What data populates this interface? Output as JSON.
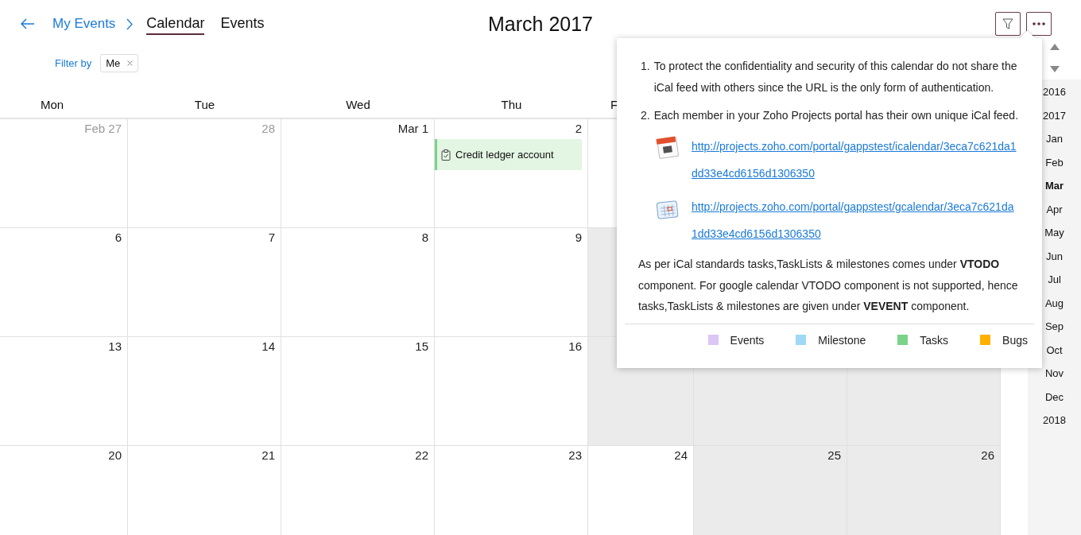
{
  "breadcrumb": "My Events",
  "tabs": [
    {
      "label": "Calendar",
      "selected": true
    },
    {
      "label": "Events",
      "selected": false
    }
  ],
  "title": "March 2017",
  "filter": {
    "label": "Filter by",
    "chips": [
      "Me"
    ]
  },
  "weekdays": [
    "Mon",
    "Tue",
    "Wed",
    "Thu",
    "F"
  ],
  "weeks": [
    {
      "days": [
        {
          "label": "Feb 27",
          "other_month": true
        },
        {
          "label": "28",
          "other_month": true
        },
        {
          "label": "Mar 1",
          "other_month": false
        },
        {
          "label": "2",
          "other_month": false,
          "events": [
            {
              "title": "Credit ledger account",
              "color": "#7bd389"
            }
          ]
        },
        {
          "shaded": false
        }
      ]
    },
    {
      "days": [
        {
          "label": "6"
        },
        {
          "label": "7"
        },
        {
          "label": "8"
        },
        {
          "label": "9"
        },
        {
          "shaded": true
        }
      ]
    },
    {
      "days": [
        {
          "label": "13"
        },
        {
          "label": "14"
        },
        {
          "label": "15"
        },
        {
          "label": "16"
        },
        {
          "shaded": true
        },
        {
          "shaded": true
        },
        {
          "shaded": true
        }
      ]
    },
    {
      "days": [
        {
          "label": "20"
        },
        {
          "label": "21"
        },
        {
          "label": "22"
        },
        {
          "label": "23"
        },
        {
          "label": "24",
          "shaded": false
        },
        {
          "label": "25",
          "shaded": true
        },
        {
          "label": "26",
          "shaded": true
        }
      ]
    }
  ],
  "popover": {
    "notes": [
      {
        "marker": "1.",
        "text": "To protect the confidentiality and security of this calendar do not share the iCal feed with others since the URL is the only form of authentication."
      },
      {
        "marker": "2.",
        "text": "Each member in your Zoho Projects portal has their own unique iCal feed."
      }
    ],
    "links": [
      {
        "kind": "ical",
        "url": "http://projects.zoho.com/portal/gappstest/icalendar/3eca7c621da1dd33e4cd6156d1306350"
      },
      {
        "kind": "gcal",
        "url": "http://projects.zoho.com/portal/gappstest/gcalendar/3eca7c621da1dd33e4cd6156d1306350"
      }
    ],
    "info": "As per iCal standards tasks,TaskLists & milestones comes under **VTODO** component. For google calendar VTODO component is not supported, hence tasks,TaskLists & milestones are given under **VEVENT** component.",
    "legend": [
      {
        "label": "Events",
        "color": "#dcc6f5"
      },
      {
        "label": "Milestone",
        "color": "#9fd9f5"
      },
      {
        "label": "Tasks",
        "color": "#7bd389"
      },
      {
        "label": "Bugs",
        "color": "#ffb000"
      }
    ]
  },
  "sidebar": [
    {
      "label": "2016",
      "selected": false
    },
    {
      "label": "2017",
      "selected": false
    },
    {
      "label": "Jan",
      "selected": false
    },
    {
      "label": "Feb",
      "selected": false
    },
    {
      "label": "Mar",
      "selected": true
    },
    {
      "label": "Apr",
      "selected": false
    },
    {
      "label": "May",
      "selected": false
    },
    {
      "label": "Jun",
      "selected": false
    },
    {
      "label": "Jul",
      "selected": false
    },
    {
      "label": "Aug",
      "selected": false
    },
    {
      "label": "Sep",
      "selected": false
    },
    {
      "label": "Oct",
      "selected": false
    },
    {
      "label": "Nov",
      "selected": false
    },
    {
      "label": "Dec",
      "selected": false
    },
    {
      "label": "2018",
      "selected": false
    }
  ]
}
